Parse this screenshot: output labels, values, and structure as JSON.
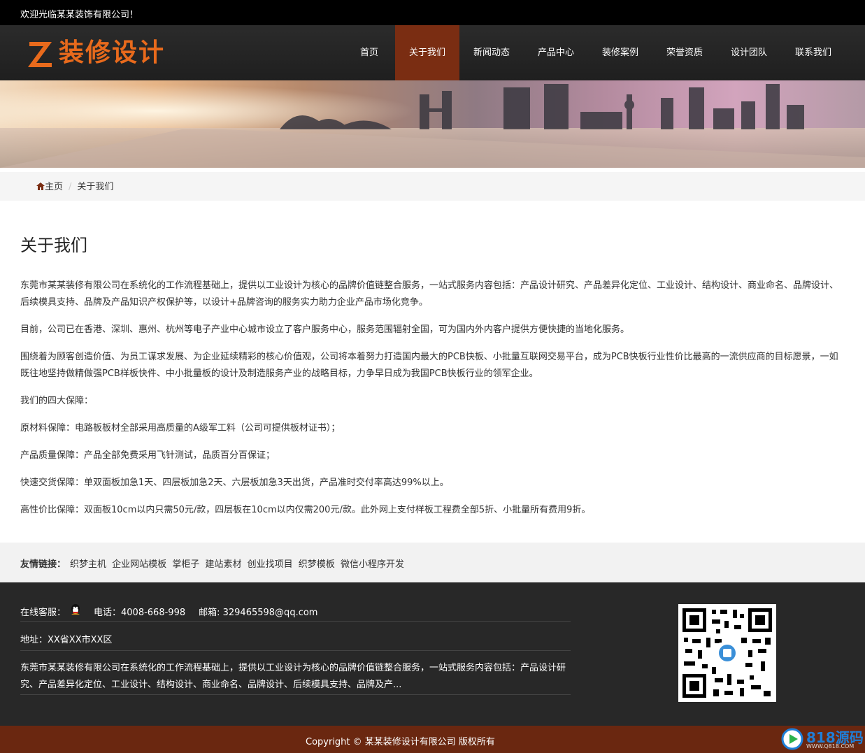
{
  "topbar": {
    "welcome": "欢迎光临某某装饰有限公司！"
  },
  "logo": {
    "text": "装修设计"
  },
  "nav": {
    "items": [
      {
        "label": "首页"
      },
      {
        "label": "关于我们"
      },
      {
        "label": "新闻动态"
      },
      {
        "label": "产品中心"
      },
      {
        "label": "装修案例"
      },
      {
        "label": "荣誉资质"
      },
      {
        "label": "设计团队"
      },
      {
        "label": "联系我们"
      }
    ],
    "active": "关于我们"
  },
  "breadcrumb": {
    "home": "主页",
    "current": "关于我们"
  },
  "page": {
    "title": "关于我们",
    "paragraphs": [
      "东莞市某某装修有限公司在系统化的工作流程基础上，提供以工业设计为核心的品牌价值链整合服务，一站式服务内容包括：产品设计研究、产品差异化定位、工业设计、结构设计、商业命名、品牌设计、后续模具支持、品牌及产品知识产权保护等，以设计+品牌咨询的服务实力助力企业产品市场化竞争。",
      "目前，公司已在香港、深圳、惠州、杭州等电子产业中心城市设立了客户服务中心，服务范围辐射全国，可为国内外内客户提供方便快捷的当地化服务。",
      "围绕着为顾客创造价值、为员工谋求发展、为企业延续精彩的核心价值观，公司将本着努力打造国内最大的PCB快板、小批量互联网交易平台，成为PCB快板行业性价比最高的一流供应商的目标愿景，一如既往地坚持做精做强PCB样板快件、中小批量板的设计及制造服务产业的战略目标，力争早日成为我国PCB快板行业的领军企业。",
      "我们的四大保障：",
      "原材料保障：电路板板材全部采用高质量的A级军工料（公司可提供板材证书）；",
      "产品质量保障：产品全部免费采用飞针测试，品质百分百保证；",
      "快速交货保障：单双面板加急1天、四层板加急2天、六层板加急3天出货，产品准时交付率高达99%以上。",
      "高性价比保障：双面板10cm以内只需50元/款，四层板在10cm以内仅需200元/款。此外网上支付样板工程费全部5折、小批量所有费用9折。"
    ]
  },
  "friend_links": {
    "label": "友情链接：",
    "items": [
      "织梦主机",
      "企业网站模板",
      "掌柜子",
      "建站素材",
      "创业找项目",
      "织梦模板",
      "微信小程序开发"
    ]
  },
  "footer": {
    "service_label": "在线客服：",
    "phone": "电话：4008-668-998",
    "email": "邮箱: 329465598@qq.com",
    "address": "地址：XX省XX市XX区",
    "intro": "东莞市某某装修有限公司在系统化的工作流程基础上，提供以工业设计为核心的品牌价值链整合服务，一站式服务内容包括：产品设计研究、产品差异化定位、工业设计、结构设计、商业命名、品牌设计、后续模具支持、品牌及产..."
  },
  "copyright": {
    "text": "Copyright © 某某装修设计有限公司 版权所有"
  },
  "watermark": {
    "text": "818源码",
    "sub": "WWW.Q818.COM"
  },
  "colors": {
    "accent": "#7a2d12",
    "logo": "#e86a1c",
    "footer_bg": "#282828",
    "copy_bg": "#6a2710"
  }
}
